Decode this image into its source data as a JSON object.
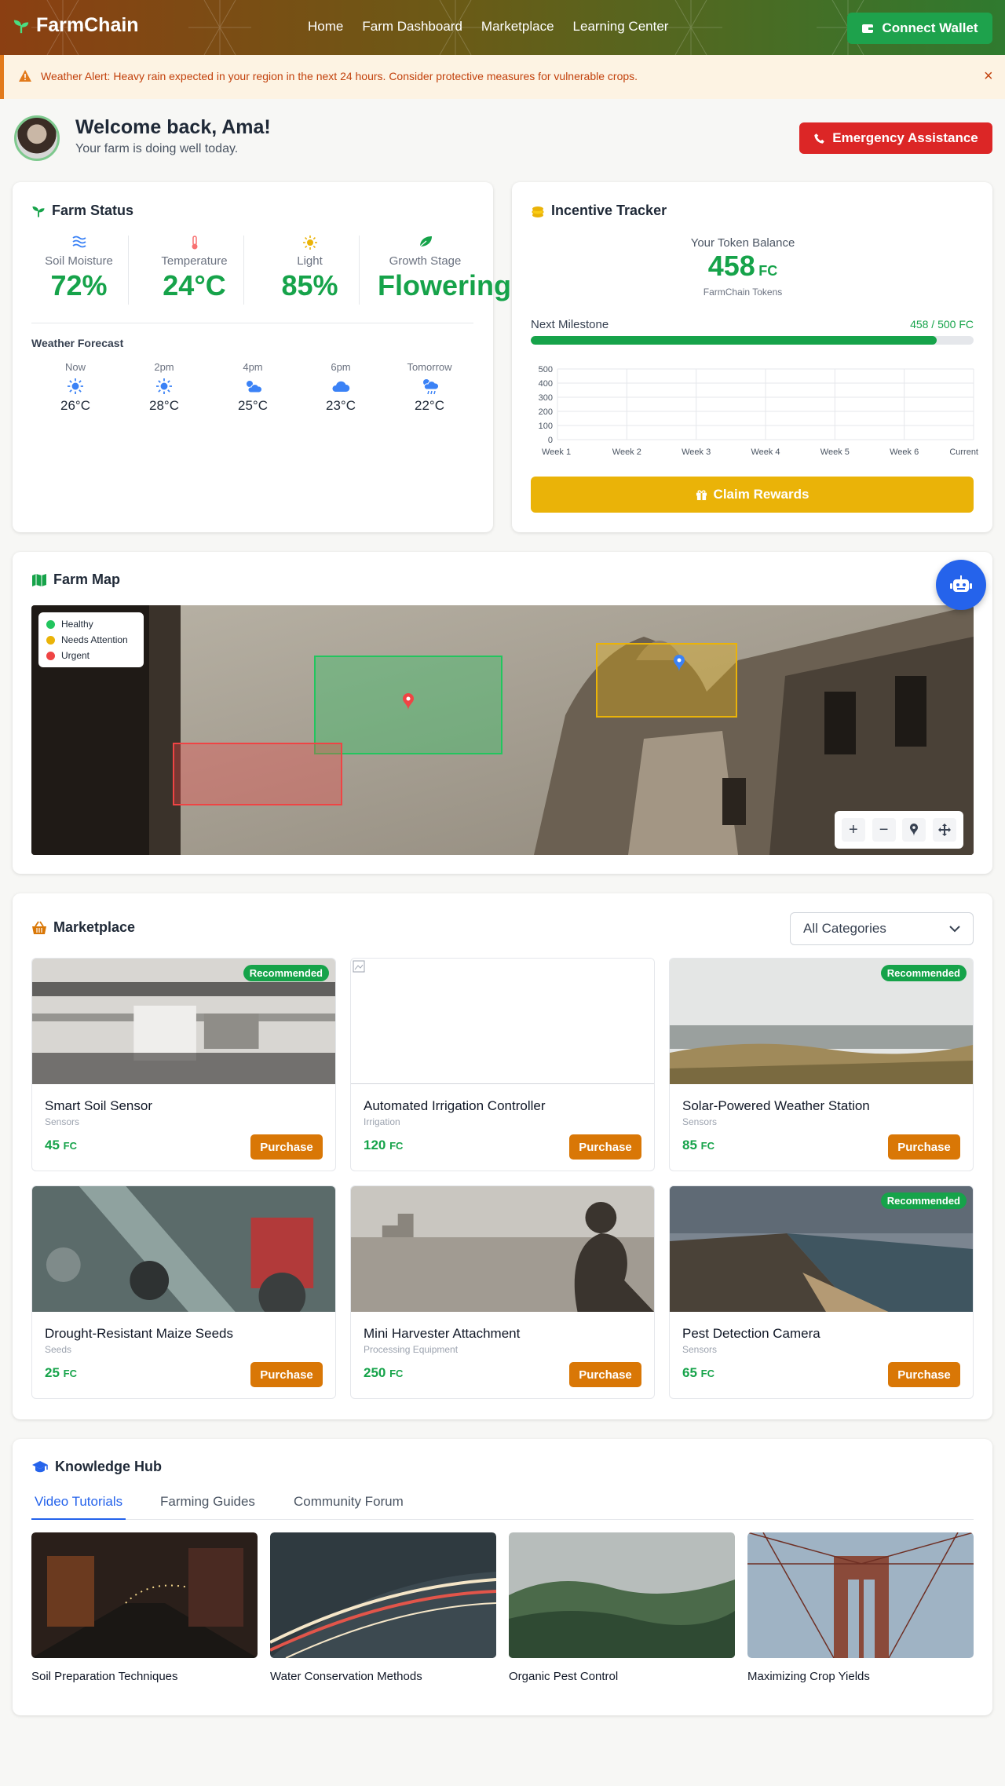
{
  "header": {
    "brand": "FarmChain",
    "nav": [
      "Home",
      "Farm Dashboard",
      "Marketplace",
      "Learning Center"
    ],
    "wallet_button": "Connect Wallet"
  },
  "alert": {
    "text": "Weather Alert: Heavy rain expected in your region in the next 24 hours. Consider protective measures for vulnerable crops.",
    "close": "×"
  },
  "welcome": {
    "title": "Welcome back, Ama!",
    "subtitle": "Your farm is doing well today.",
    "emergency_button": "Emergency Assistance"
  },
  "farm_status": {
    "title": "Farm Status",
    "metrics": [
      {
        "label": "Soil Moisture",
        "value": "72%",
        "icon": "water-icon"
      },
      {
        "label": "Temperature",
        "value": "24°C",
        "icon": "thermometer-icon"
      },
      {
        "label": "Light",
        "value": "85%",
        "icon": "sun-icon"
      },
      {
        "label": "Growth Stage",
        "value": "Flowering",
        "icon": "leaf-icon"
      }
    ],
    "forecast_title": "Weather Forecast",
    "forecast": [
      {
        "time": "Now",
        "temp": "26°C",
        "icon": "sun-icon"
      },
      {
        "time": "2pm",
        "temp": "28°C",
        "icon": "sun-icon"
      },
      {
        "time": "4pm",
        "temp": "25°C",
        "icon": "partly-cloudy-icon"
      },
      {
        "time": "6pm",
        "temp": "23°C",
        "icon": "cloud-icon"
      },
      {
        "time": "Tomorrow",
        "temp": "22°C",
        "icon": "rain-sun-icon"
      }
    ]
  },
  "incentive": {
    "title": "Incentive Tracker",
    "balance_label": "Your Token Balance",
    "balance": "458",
    "unit": "FC",
    "balance_sub": "FarmChain Tokens",
    "milestone_label": "Next Milestone",
    "milestone_value": "458 / 500 FC",
    "progress": 0.916,
    "claim_button": "Claim Rewards"
  },
  "chart_data": {
    "type": "line",
    "categories": [
      "Week 1",
      "Week 2",
      "Week 3",
      "Week 4",
      "Week 5",
      "Week 6",
      "Current"
    ],
    "yticks": [
      "500",
      "400",
      "300",
      "200",
      "100",
      "0"
    ],
    "ylim": [
      0,
      500
    ],
    "grid": true,
    "series": []
  },
  "farm_map": {
    "title": "Farm Map",
    "legend": [
      {
        "label": "Healthy",
        "color": "#22c55e"
      },
      {
        "label": "Needs Attention",
        "color": "#eab308"
      },
      {
        "label": "Urgent",
        "color": "#ef4444"
      }
    ]
  },
  "marketplace": {
    "title": "Marketplace",
    "category_select": "All Categories",
    "badge": "Recommended",
    "purchase": "Purchase",
    "unit": "FC",
    "products": [
      {
        "name": "Smart Soil Sensor",
        "category": "Sensors",
        "price": "45",
        "recommended": true
      },
      {
        "name": "Automated Irrigation Controller",
        "category": "Irrigation",
        "price": "120",
        "recommended": false
      },
      {
        "name": "Solar-Powered Weather Station",
        "category": "Sensors",
        "price": "85",
        "recommended": true
      },
      {
        "name": "Drought-Resistant Maize Seeds",
        "category": "Seeds",
        "price": "25",
        "recommended": false
      },
      {
        "name": "Mini Harvester Attachment",
        "category": "Processing Equipment",
        "price": "250",
        "recommended": false
      },
      {
        "name": "Pest Detection Camera",
        "category": "Sensors",
        "price": "65",
        "recommended": true
      }
    ]
  },
  "knowledge": {
    "title": "Knowledge Hub",
    "tabs": [
      "Video Tutorials",
      "Farming Guides",
      "Community Forum"
    ],
    "videos": [
      "Soil Preparation Techniques",
      "Water Conservation Methods",
      "Organic Pest Control",
      "Maximizing Crop Yields"
    ]
  },
  "colors": {
    "primary": "#16a34a",
    "danger": "#dc2626",
    "warning": "#eab308",
    "accent": "#d97706",
    "link": "#2563eb"
  }
}
